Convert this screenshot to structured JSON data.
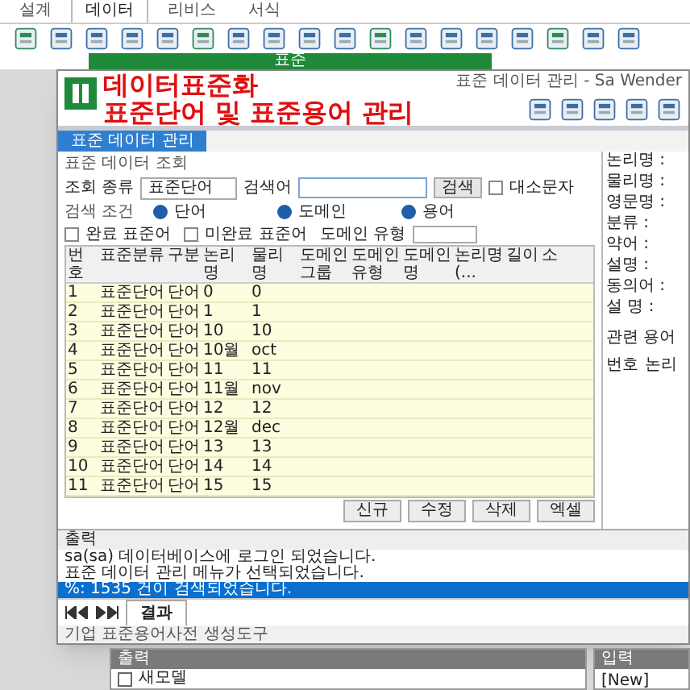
{
  "app_tabs": [
    {
      "label": "설계",
      "selected": false
    },
    {
      "label": "데이터",
      "selected": true
    },
    {
      "label": "리비스",
      "selected": false
    },
    {
      "label": "서식",
      "selected": false
    }
  ],
  "app_ribbon": {
    "group_label": "표준"
  },
  "window": {
    "title": "표준 데이터 관리 - Sa Wender",
    "overlay_title": "데이터표준화",
    "overlay_subtitle": "표준단어 및 표준용어 관리"
  },
  "doc_tab": "표준 데이터 관리",
  "query": {
    "legend": "표준 데이터 조회",
    "kind_label": "조회 종류",
    "kind_value": "표준단어",
    "search_label": "검색어",
    "search_button": "검색",
    "case_label": "대소문자",
    "case_checked": false
  },
  "conditions": {
    "legend": "검색 조건",
    "radios": [
      {
        "label": "단어",
        "selected": true
      },
      {
        "label": "도메인",
        "selected": true
      },
      {
        "label": "용어",
        "selected": true
      }
    ],
    "checks": [
      {
        "label": "완료 표준어",
        "checked": false
      },
      {
        "label": "미완료 표준어",
        "checked": false
      }
    ],
    "domain_type_label": "도메인 유형"
  },
  "table": {
    "columns": [
      "번호",
      "표준분류",
      "구분",
      "논리명",
      "물리명",
      "도메인그룹",
      "도메인 유형",
      "도메인명",
      "논리명(...",
      "길이",
      "소"
    ],
    "rows": [
      [
        "1",
        "표준단어",
        "단어",
        "0",
        "0"
      ],
      [
        "2",
        "표준단어",
        "단어",
        "1",
        "1"
      ],
      [
        "3",
        "표준단어",
        "단어",
        "10",
        "10"
      ],
      [
        "4",
        "표준단어",
        "단어",
        "10월",
        "oct"
      ],
      [
        "5",
        "표준단어",
        "단어",
        "11",
        "11"
      ],
      [
        "6",
        "표준단어",
        "단어",
        "11월",
        "nov"
      ],
      [
        "7",
        "표준단어",
        "단어",
        "12",
        "12"
      ],
      [
        "8",
        "표준단어",
        "단어",
        "12월",
        "dec"
      ],
      [
        "9",
        "표준단어",
        "단어",
        "13",
        "13"
      ],
      [
        "10",
        "표준단어",
        "단어",
        "14",
        "14"
      ],
      [
        "11",
        "표준단어",
        "단어",
        "15",
        "15"
      ]
    ]
  },
  "buttons": [
    "신규",
    "수정",
    "삭제",
    "엑셀"
  ],
  "detail": {
    "fields": [
      "논리명 :",
      "물리명 :",
      "영문명 :",
      "분류 :",
      "약어 :",
      "설명 :",
      "동의어 :",
      "설 명 :"
    ],
    "list_title": "관련 용어",
    "list_columns": [
      "번호",
      "논리"
    ]
  },
  "output": {
    "title": "출력",
    "lines": [
      {
        "text": "sa(sa) 데이터베이스에 로그인 되었습니다.",
        "selected": false
      },
      {
        "text": "표준 데이터 관리 메뉴가 선택되었습니다.",
        "selected": false
      },
      {
        "text": "%: 1535 건이 검색되었습니다.",
        "selected": true
      }
    ],
    "tab": "결과"
  },
  "status": "기업 표준용어사전 생성도구",
  "bottom": {
    "title": "출력",
    "item": "새모델",
    "side_title": "입력",
    "side_value": "[New]"
  }
}
